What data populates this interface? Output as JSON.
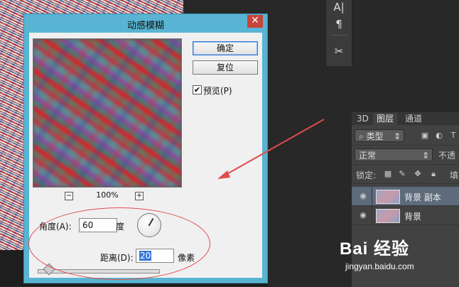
{
  "dialog": {
    "title": "动感模糊",
    "close_glyph": "✕",
    "ok_label": "确定",
    "reset_label": "复位",
    "preview_label": "预览(P)",
    "preview_checked": true,
    "zoom_out_glyph": "−",
    "zoom_in_glyph": "+",
    "zoom_level": "100%",
    "angle_label": "角度(A):",
    "angle_value": "60",
    "angle_unit": "度",
    "distance_label": "距离(D):",
    "distance_value": "20",
    "distance_unit": "像素"
  },
  "toolbar": {
    "tools": [
      {
        "icon": "character-icon",
        "glyph": "A|"
      },
      {
        "icon": "paragraph-icon",
        "glyph": "¶"
      },
      {
        "icon": "tool-presets-icon",
        "glyph": "✂"
      }
    ]
  },
  "layers_panel": {
    "tabs": [
      "3D",
      "图层",
      "通道"
    ],
    "active_tab": "图层",
    "filter_label": "类型",
    "blend_mode": "正常",
    "opacity_label": "不透",
    "lock_label": "锁定:",
    "fill_label": "填",
    "layers": [
      {
        "name": "背景 副本",
        "visible": true,
        "selected": true
      },
      {
        "name": "背景",
        "visible": true,
        "selected": false
      }
    ]
  },
  "watermark": {
    "main": "Bai 经验",
    "sub": "jingyan.baidu.com"
  },
  "colors": {
    "dialog_frame": "#58b4d2",
    "close_button": "#c7443a",
    "annotation": "#e04b4b",
    "selected_layer": "#5d6b7b"
  }
}
